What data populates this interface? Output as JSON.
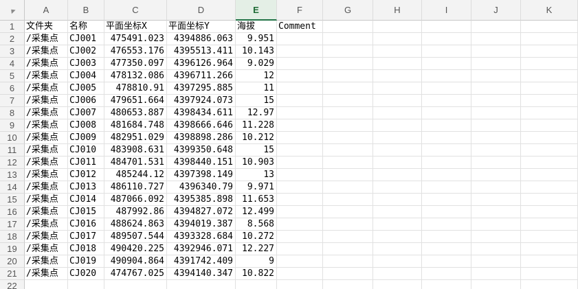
{
  "columns": [
    "A",
    "B",
    "C",
    "D",
    "E",
    "F",
    "G",
    "H",
    "I",
    "J",
    "K"
  ],
  "selected_column": "E",
  "header_row": [
    "文件夹",
    "名称",
    "平面坐标X",
    "平面坐标Y",
    "海拔",
    "Comment"
  ],
  "rows": [
    [
      "/采集点",
      "CJ001",
      "475491.023",
      "4394886.063",
      "9.951"
    ],
    [
      "/采集点",
      "CJ002",
      "476553.176",
      "4395513.411",
      "10.143"
    ],
    [
      "/采集点",
      "CJ003",
      "477350.097",
      "4396126.964",
      "9.029"
    ],
    [
      "/采集点",
      "CJ004",
      "478132.086",
      "4396711.266",
      "12"
    ],
    [
      "/采集点",
      "CJ005",
      "478810.91",
      "4397295.885",
      "11"
    ],
    [
      "/采集点",
      "CJ006",
      "479651.664",
      "4397924.073",
      "15"
    ],
    [
      "/采集点",
      "CJ007",
      "480653.887",
      "4398434.611",
      "12.97"
    ],
    [
      "/采集点",
      "CJ008",
      "481684.748",
      "4398666.646",
      "11.228"
    ],
    [
      "/采集点",
      "CJ009",
      "482951.029",
      "4398898.286",
      "10.212"
    ],
    [
      "/采集点",
      "CJ010",
      "483908.631",
      "4399350.648",
      "15"
    ],
    [
      "/采集点",
      "CJ011",
      "484701.531",
      "4398440.151",
      "10.903"
    ],
    [
      "/采集点",
      "CJ012",
      "485244.12",
      "4397398.149",
      "13"
    ],
    [
      "/采集点",
      "CJ013",
      "486110.727",
      "4396340.79",
      "9.971"
    ],
    [
      "/采集点",
      "CJ014",
      "487066.092",
      "4395385.898",
      "11.653"
    ],
    [
      "/采集点",
      "CJ015",
      "487992.86",
      "4394827.072",
      "12.499"
    ],
    [
      "/采集点",
      "CJ016",
      "488624.863",
      "4394019.387",
      "8.568"
    ],
    [
      "/采集点",
      "CJ017",
      "489507.544",
      "4393328.684",
      "10.272"
    ],
    [
      "/采集点",
      "CJ018",
      "490420.225",
      "4392946.071",
      "12.227"
    ],
    [
      "/采集点",
      "CJ019",
      "490904.864",
      "4391742.409",
      "9"
    ],
    [
      "/采集点",
      "CJ020",
      "474767.025",
      "4394140.347",
      "10.822"
    ]
  ],
  "row_numbers": [
    "1",
    "2",
    "3",
    "4",
    "5",
    "6",
    "7",
    "8",
    "9",
    "10",
    "11",
    "12",
    "13",
    "14",
    "15",
    "16",
    "17",
    "18",
    "19",
    "20",
    "21",
    "22"
  ],
  "colors": {
    "accent": "#217346",
    "grid": "#e1e1e1",
    "header_bg": "#f3f3f3"
  }
}
